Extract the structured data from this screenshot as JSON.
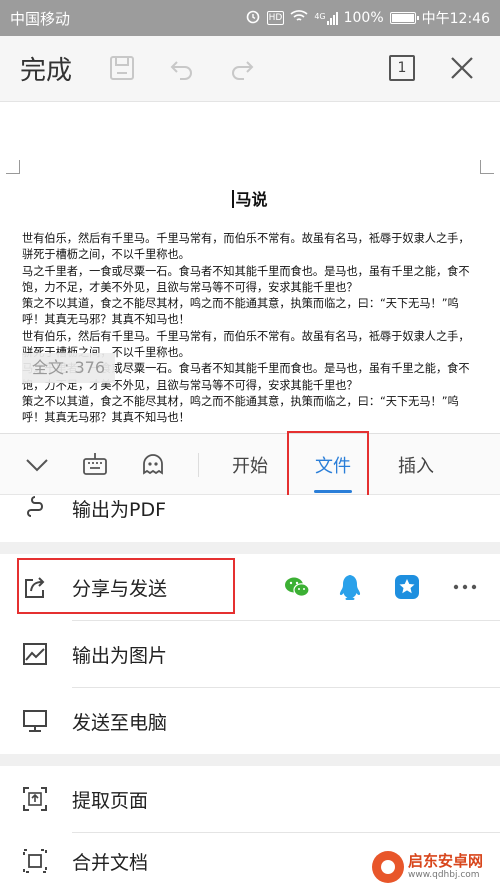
{
  "status_bar": {
    "carrier": "中国移动",
    "signal": "4G",
    "battery": "100%",
    "time": "中午12:46"
  },
  "toolbar": {
    "done_label": "完成",
    "page_count": "1"
  },
  "document": {
    "title": "马说",
    "paragraphs": [
      "世有伯乐，然后有千里马。千里马常有，而伯乐不常有。故虽有名马，祗辱于奴隶人之手，",
      "骈死于槽枥之间，不以千里称也。",
      "马之千里者，一食或尽粟一石。食马者不知其能千里而食也。是马也，虽有千里之能，食不",
      "饱，力不足，才美不外见，且欲与常马等不可得，安求其能千里也？",
      "策之不以其道，食之不能尽其材，鸣之而不能通其意，执策而临之，曰：“天下无马！”呜",
      "呼！其真无马邪？其真不知马也！",
      " 世有伯乐，然后有千里马。千里马常有，而伯乐不常有。故虽有名马，祗辱于奴隶人之手，",
      "骈死于槽枥之间，不以千里称也。",
      "马之千里者，一食或尽粟一石。食马者不知其能千里而食也。是马也，虽有千里之能，食不",
      "饱，力不足，才美不外见，且欲与常马等不可得，安求其能千里也？",
      "策之不以其道，食之不能尽其材，鸣之而不能通其意，执策而临之，曰：“天下无马！”呜",
      "呼！其真无马邪？其真不知马也！"
    ],
    "word_count": "全文: 376"
  },
  "tabs": {
    "items": [
      "开始",
      "文件",
      "插入"
    ],
    "active": "文件"
  },
  "menu": {
    "export_pdf": "输出为PDF",
    "share_send": "分享与发送",
    "export_image": "输出为图片",
    "send_pc": "发送至电脑",
    "extract_page": "提取页面",
    "merge_doc": "合并文档"
  },
  "watermark": {
    "name": "启东安卓网",
    "url": "www.qdhbj.com"
  },
  "colors": {
    "accent": "#2a7ed8",
    "highlight": "#e53030",
    "wechat": "#3cb034",
    "qq": "#2aa1ea",
    "star_app": "#1e8fdf"
  }
}
